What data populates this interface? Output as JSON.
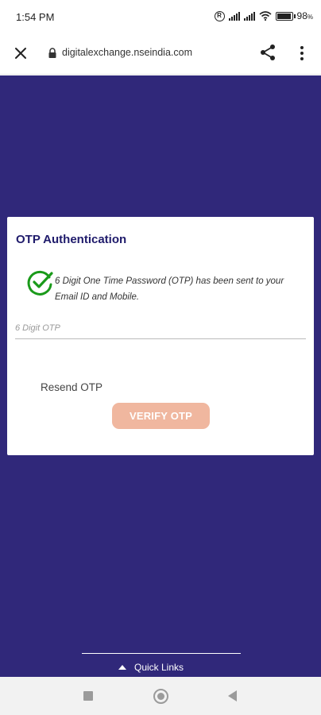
{
  "status_bar": {
    "time": "1:54 PM",
    "battery": "98",
    "battery_unit": "%",
    "battery_level": 0.98,
    "icons": [
      "r-circle-icon",
      "signal-icon",
      "signal-icon",
      "wifi-icon",
      "battery-icon"
    ]
  },
  "browser": {
    "url": "digitalexchange.nseindia.com",
    "icons": [
      "close-icon",
      "lock-icon",
      "share-icon",
      "more-vert-icon"
    ]
  },
  "page": {
    "background_color": "#30287a",
    "card": {
      "title": "OTP Authentication",
      "info_text": "6 Digit One Time Password (OTP) has been sent to your Email ID and Mobile.",
      "otp_placeholder": "6 Digit OTP",
      "otp_value": "",
      "resend_label": "Resend OTP",
      "verify_label": "VERIFY OTP",
      "verify_color": "#f0b79f",
      "check_icon_color": "#1a9a1a"
    },
    "quick_links_label": "Quick Links"
  },
  "nav_bar": {
    "icons": [
      "recents-icon",
      "home-icon",
      "back-icon"
    ]
  }
}
